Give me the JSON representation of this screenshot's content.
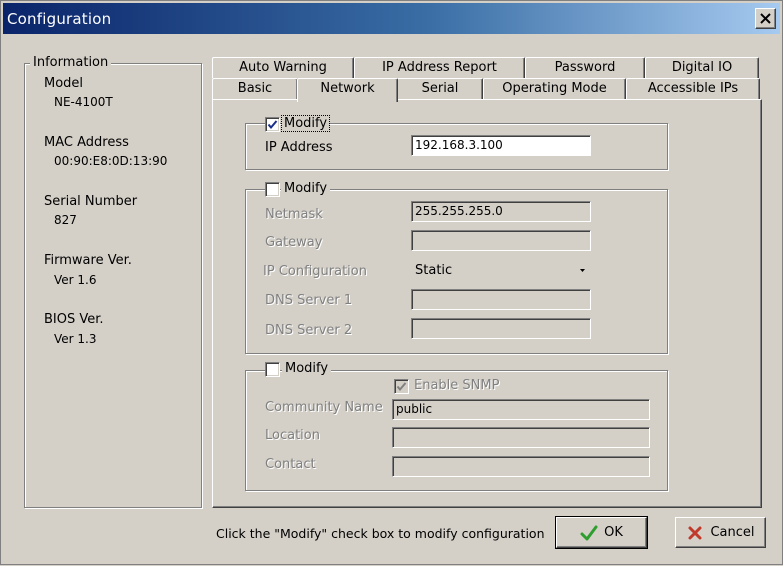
{
  "window": {
    "title": "Configuration"
  },
  "info": {
    "legend": "Information",
    "items": [
      {
        "label": "Model",
        "value": "NE-4100T"
      },
      {
        "label": "MAC Address",
        "value": "00:90:E8:0D:13:90"
      },
      {
        "label": "Serial Number",
        "value": "827"
      },
      {
        "label": "Firmware Ver.",
        "value": "Ver 1.6"
      },
      {
        "label": "BIOS Ver.",
        "value": "Ver 1.3"
      }
    ]
  },
  "tabs": {
    "back_row": [
      "Auto Warning",
      "IP Address Report",
      "Password",
      "Digital IO"
    ],
    "front_row": [
      "Basic",
      "Network",
      "Serial",
      "Operating Mode",
      "Accessible IPs"
    ],
    "active": "Network"
  },
  "network": {
    "group1": {
      "modify_label": "Modify",
      "modify_checked": true,
      "ip_label": "IP Address",
      "ip_value": "192.168.3.100"
    },
    "group2": {
      "modify_label": "Modify",
      "modify_checked": false,
      "netmask_label": "Netmask",
      "netmask_value": "255.255.255.0",
      "gateway_label": "Gateway",
      "gateway_value": "",
      "ipconfig_label": "IP Configuration",
      "ipconfig_value": "Static",
      "dns1_label": "DNS Server 1",
      "dns1_value": "",
      "dns2_label": "DNS Server 2",
      "dns2_value": ""
    },
    "group3": {
      "modify_label": "Modify",
      "modify_checked": false,
      "snmp_label": "Enable SNMP",
      "snmp_checked": true,
      "community_label": "Community Name",
      "community_value": "public",
      "location_label": "Location",
      "location_value": "",
      "contact_label": "Contact",
      "contact_value": ""
    }
  },
  "footer": {
    "hint": "Click the \"Modify\" check box to modify configuration",
    "ok_label": "OK",
    "cancel_label": "Cancel"
  },
  "icons": {
    "close": "close-icon",
    "check": "checkmark-icon",
    "ok": "green-check-icon",
    "cancel": "red-x-icon"
  },
  "colors": {
    "titlebar_start": "#0a246a",
    "titlebar_end": "#a6caf0",
    "face": "#d4d0c8",
    "ok_icon": "#2e9e2e",
    "cancel_icon": "#c0392b"
  }
}
